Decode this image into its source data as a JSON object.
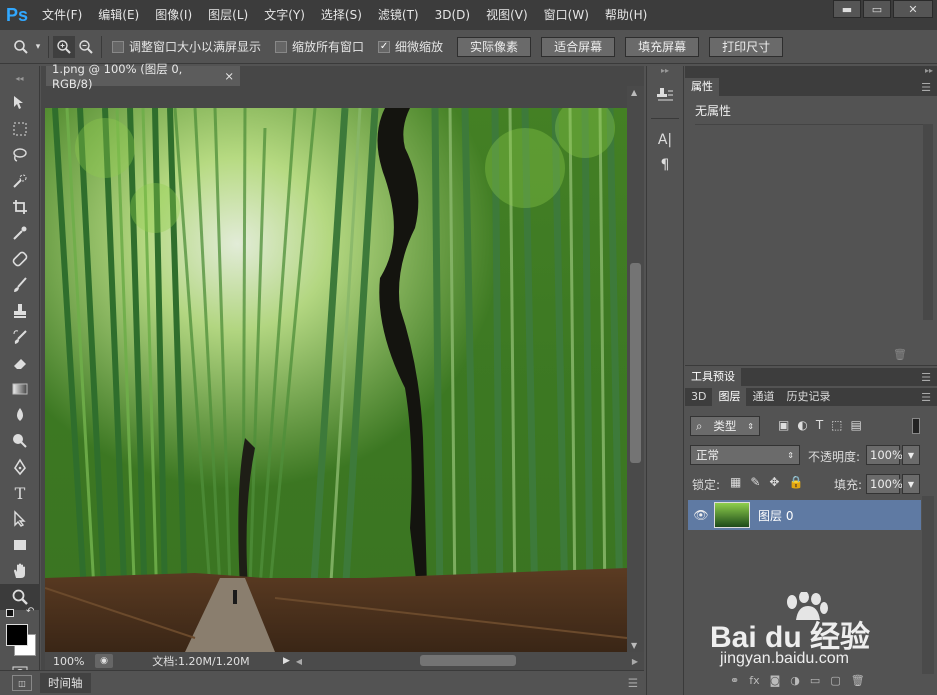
{
  "app": {
    "logo": "Ps"
  },
  "menu": [
    "文件(F)",
    "编辑(E)",
    "图像(I)",
    "图层(L)",
    "文字(Y)",
    "选择(S)",
    "滤镜(T)",
    "3D(D)",
    "视图(V)",
    "窗口(W)",
    "帮助(H)"
  ],
  "window_controls": {
    "min": "▬",
    "max": "▭",
    "close": "✕"
  },
  "options": {
    "chk_resize": "调整窗口大小以满屏显示",
    "chk_all": "缩放所有窗口",
    "chk_scrubby": "细微缩放",
    "btn_actual": "实际像素",
    "btn_fit": "适合屏幕",
    "btn_fill": "填充屏幕",
    "btn_print": "打印尺寸"
  },
  "document": {
    "tab_title": "1.png @ 100% (图层 0, RGB/8)",
    "tab_close": "×",
    "zoom": "100%",
    "doc_info": "文档:1.20M/1.20M"
  },
  "timeline": {
    "label": "时间轴"
  },
  "properties": {
    "title": "属性",
    "empty_text": "无属性"
  },
  "tool_presets": {
    "title": "工具预设"
  },
  "layers_panel": {
    "tabs": [
      "3D",
      "图层",
      "通道",
      "历史记录"
    ],
    "filter_kind": "类型",
    "blend_mode": "正常",
    "opacity_label": "不透明度:",
    "opacity_value": "100%",
    "lock_label": "锁定:",
    "fill_label": "填充:",
    "fill_value": "100%",
    "layers": [
      {
        "name": "图层 0",
        "visible": true
      }
    ]
  },
  "watermark": {
    "brand": "Bai du 经验",
    "url": "jingyan.baidu.com"
  }
}
